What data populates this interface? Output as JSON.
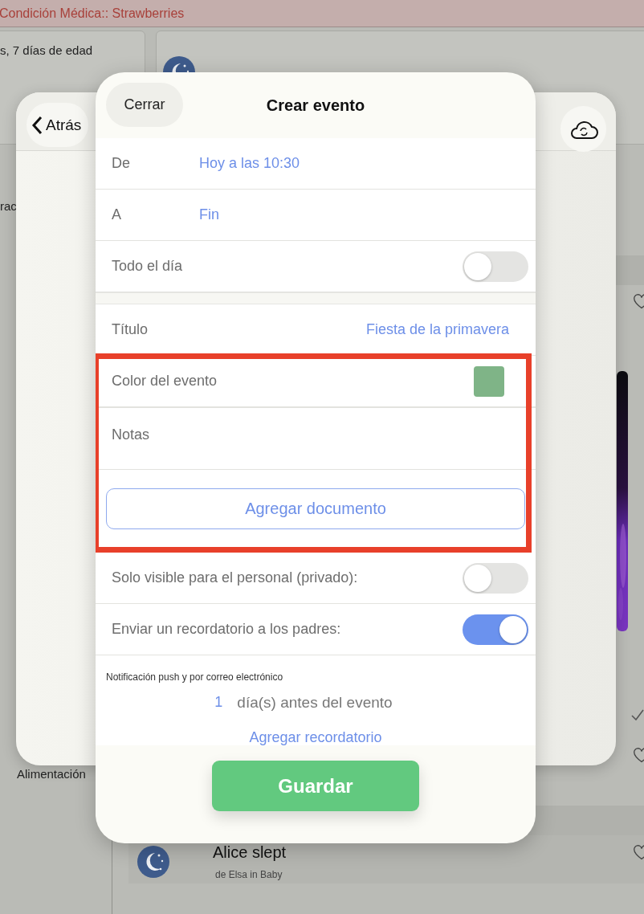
{
  "background": {
    "banner": "Condición Médica:: Strawberries",
    "age_text": "s, 7 días de edad",
    "side_label": "rac",
    "tab_labels": [
      "Alimentación"
    ],
    "feed_item": {
      "title": "Alice slept",
      "subtitle": "de Elsa in Baby"
    }
  },
  "back_sheet": {
    "back_button": "Atrás"
  },
  "modal": {
    "close_button": "Cerrar",
    "title": "Crear evento",
    "groups": [
      {
        "highlighted": false,
        "gap_before": false,
        "rows": [
          {
            "kind": "value",
            "label": "De",
            "value": "Hoy a las 10:30"
          },
          {
            "kind": "value",
            "label": "A",
            "value": "Fin"
          },
          {
            "kind": "toggle",
            "label": "Todo el día",
            "on": false
          }
        ]
      },
      {
        "highlighted": false,
        "gap_before": true,
        "rows": [
          {
            "kind": "value_right",
            "label": "Título",
            "value": "Fiesta de la primavera"
          }
        ]
      },
      {
        "highlighted": true,
        "gap_before": false,
        "rows": [
          {
            "kind": "color",
            "label": "Color del evento",
            "color": "#7fb487"
          },
          {
            "kind": "notes",
            "label": "Notas"
          },
          {
            "kind": "button",
            "label": "Agregar documento"
          }
        ]
      },
      {
        "highlighted": false,
        "gap_before": false,
        "rows": [
          {
            "kind": "toggle",
            "label": "Solo visible para el personal (privado):",
            "on": false
          },
          {
            "kind": "toggle",
            "label": "Enviar un recordatorio a los padres:",
            "on": true
          }
        ]
      }
    ],
    "notification_note": "Notificación push y por correo electrónico",
    "reminder": {
      "count": "1",
      "text": "día(s) antes del evento"
    },
    "add_reminder": "Agregar recordatorio",
    "save_button": "Guardar"
  }
}
